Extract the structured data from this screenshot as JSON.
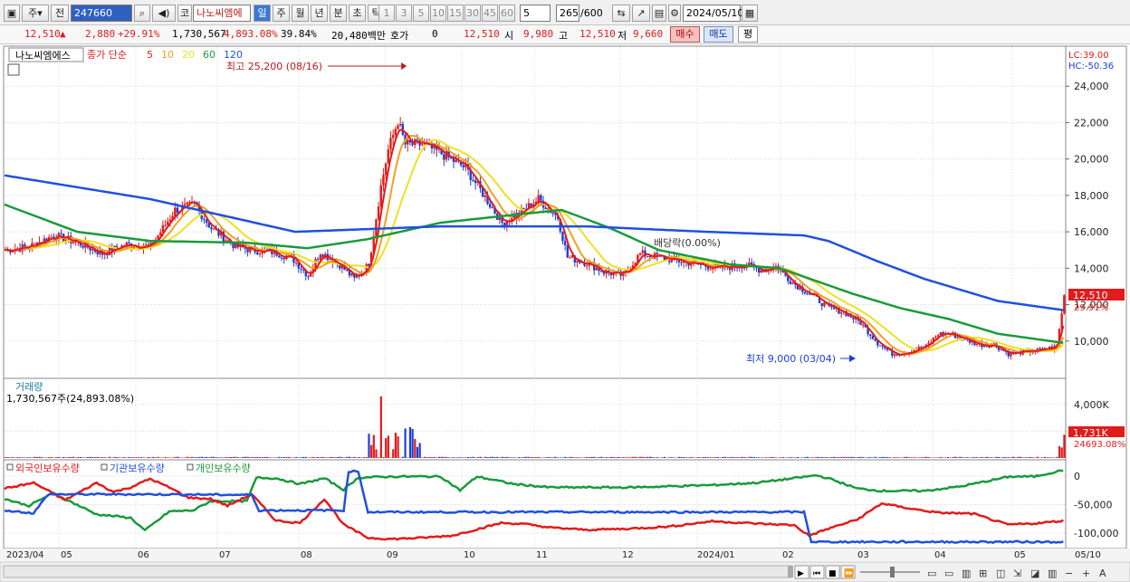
{
  "toolbar": {
    "market": "주",
    "prev": "전",
    "code": "247660",
    "stock_name": "나노씨엠에",
    "chart_type": "코",
    "periods": [
      "일",
      "주",
      "월",
      "년",
      "분",
      "초",
      "틱"
    ],
    "active_period": "일",
    "intervals": [
      "1",
      "3",
      "5",
      "10",
      "15",
      "30",
      "45",
      "60"
    ],
    "interval_input": "5",
    "count": "265",
    "count_max": "/600",
    "date": "2024/05/10"
  },
  "quote": {
    "price": "12,510",
    "change": "2,880",
    "change_pct": "+29.91%",
    "volume": "1,730,567",
    "vol_ratio": "4,893.08%",
    "turnover_pct": "39.84%",
    "amount": "20,480백만",
    "hoga_label": "호가",
    "hoga_val": "0",
    "ask": "12,510",
    "open_label": "시",
    "open": "9,980",
    "high_label": "고",
    "high": "12,510",
    "low_label": "저",
    "low": "9,660",
    "buy_label": "매수",
    "sell_label": "매도",
    "eval_label": "평"
  },
  "chart_data": {
    "type": "candlestick",
    "legend": {
      "name": "나노씨엠에스",
      "ma_label": "종가 단순",
      "ma_periods": [
        "5",
        "10",
        "20",
        "60",
        "120"
      ],
      "ma_colors": [
        "#e21b1b",
        "#f0a020",
        "#f0e020",
        "#1a9a3a",
        "#2050e0"
      ]
    },
    "price_axis": {
      "ticks": [
        "24,000",
        "22,000",
        "20,000",
        "18,000",
        "16,000",
        "14,000",
        "12,000",
        "10,000"
      ],
      "ylim": [
        8000,
        26000
      ]
    },
    "lc": "LC:39.00",
    "hc": "HC:-50.36",
    "last_price_tag": "12,510",
    "last_pct_tag": "29.91%",
    "high_annotation": "최고 25,200 (08/16)",
    "low_annotation": "최저 9,000 (03/04)",
    "dividend_annotation": "배당락(0.00%)",
    "volume": {
      "title": "거래량",
      "info": "1,730,567주(24,893.08%)",
      "ticks": [
        "4,000K",
        "2,000K"
      ],
      "tag": "1,731K",
      "tag_pct": "24693.08%",
      "ylim": [
        0,
        5000
      ]
    },
    "holdings": {
      "series": [
        {
          "name": "외국인보유수량",
          "color": "#e21b1b"
        },
        {
          "name": "기관보유수량",
          "color": "#2050e0"
        },
        {
          "name": "개인보유수량",
          "color": "#1a9a3a"
        }
      ],
      "ticks": [
        "0",
        "-50,000",
        "-100,000"
      ],
      "ylim": [
        -125000,
        25000
      ]
    },
    "x_labels": [
      "2023/04",
      "05",
      "06",
      "07",
      "08",
      "09",
      "10",
      "11",
      "12",
      "2024/01",
      "02",
      "03",
      "04",
      "05",
      "05/10"
    ],
    "close_path": [
      [
        0,
        15000
      ],
      [
        10,
        15200
      ],
      [
        20,
        15800
      ],
      [
        30,
        15400
      ],
      [
        40,
        14800
      ],
      [
        50,
        15300
      ],
      [
        60,
        15200
      ],
      [
        70,
        17200
      ],
      [
        78,
        17500
      ],
      [
        85,
        16200
      ],
      [
        95,
        15200
      ],
      [
        102,
        15000
      ],
      [
        110,
        14900
      ],
      [
        118,
        14600
      ],
      [
        125,
        13600
      ],
      [
        130,
        14900
      ],
      [
        138,
        14200
      ],
      [
        144,
        13400
      ],
      [
        150,
        14200
      ],
      [
        155,
        18500
      ],
      [
        158,
        20500
      ],
      [
        162,
        22100
      ],
      [
        165,
        20800
      ],
      [
        172,
        20800
      ],
      [
        180,
        20300
      ],
      [
        190,
        19500
      ],
      [
        197,
        18100
      ],
      [
        205,
        16500
      ],
      [
        212,
        17000
      ],
      [
        220,
        17800
      ],
      [
        228,
        16800
      ],
      [
        232,
        14600
      ],
      [
        240,
        14300
      ],
      [
        247,
        13800
      ],
      [
        255,
        13600
      ],
      [
        262,
        14800
      ],
      [
        270,
        14600
      ],
      [
        282,
        14300
      ],
      [
        295,
        14000
      ],
      [
        305,
        14200
      ],
      [
        312,
        13900
      ],
      [
        318,
        14100
      ],
      [
        325,
        13200
      ],
      [
        333,
        12500
      ],
      [
        340,
        11800
      ],
      [
        346,
        11600
      ],
      [
        353,
        11000
      ],
      [
        360,
        9900
      ],
      [
        366,
        9300
      ],
      [
        372,
        9400
      ],
      [
        380,
        9700
      ],
      [
        385,
        10400
      ],
      [
        390,
        10400
      ],
      [
        396,
        10100
      ],
      [
        402,
        9800
      ],
      [
        408,
        9800
      ],
      [
        414,
        9300
      ],
      [
        420,
        9400
      ],
      [
        428,
        9500
      ],
      [
        434,
        9700
      ],
      [
        437,
        12510
      ]
    ],
    "ma120_path": [
      [
        0,
        19100
      ],
      [
        60,
        17800
      ],
      [
        120,
        16000
      ],
      [
        180,
        16300
      ],
      [
        240,
        16300
      ],
      [
        290,
        16000
      ],
      [
        330,
        15800
      ],
      [
        340,
        15500
      ],
      [
        360,
        14400
      ],
      [
        380,
        13400
      ],
      [
        410,
        12200
      ],
      [
        437,
        11700
      ]
    ],
    "ma60_path": [
      [
        0,
        17500
      ],
      [
        30,
        16000
      ],
      [
        60,
        15500
      ],
      [
        100,
        15400
      ],
      [
        125,
        15100
      ],
      [
        150,
        15600
      ],
      [
        180,
        16500
      ],
      [
        215,
        17000
      ],
      [
        230,
        17200
      ],
      [
        250,
        16200
      ],
      [
        270,
        15000
      ],
      [
        300,
        14200
      ],
      [
        320,
        14000
      ],
      [
        335,
        13300
      ],
      [
        350,
        12600
      ],
      [
        370,
        11800
      ],
      [
        390,
        11200
      ],
      [
        410,
        10400
      ],
      [
        437,
        9900
      ]
    ],
    "foreign_path": [
      [
        0,
        -22000
      ],
      [
        12,
        -12000
      ],
      [
        25,
        -42000
      ],
      [
        38,
        -12000
      ],
      [
        45,
        -28000
      ],
      [
        52,
        -20000
      ],
      [
        60,
        -5000
      ],
      [
        68,
        -20000
      ],
      [
        76,
        -38000
      ],
      [
        85,
        -40000
      ],
      [
        92,
        -52000
      ],
      [
        102,
        -32000
      ],
      [
        112,
        -78000
      ],
      [
        122,
        -82000
      ],
      [
        132,
        -40000
      ],
      [
        140,
        -85000
      ],
      [
        150,
        -108000
      ],
      [
        160,
        -110000
      ],
      [
        172,
        -108000
      ],
      [
        185,
        -104000
      ],
      [
        205,
        -82000
      ],
      [
        215,
        -84000
      ],
      [
        225,
        -90000
      ],
      [
        240,
        -94000
      ],
      [
        258,
        -92000
      ],
      [
        275,
        -88000
      ],
      [
        292,
        -79000
      ],
      [
        310,
        -83000
      ],
      [
        326,
        -86000
      ],
      [
        332,
        -104000
      ],
      [
        340,
        -92000
      ],
      [
        352,
        -76000
      ],
      [
        362,
        -48000
      ],
      [
        374,
        -57000
      ],
      [
        385,
        -64000
      ],
      [
        400,
        -66000
      ],
      [
        414,
        -85000
      ],
      [
        425,
        -83000
      ],
      [
        437,
        -78000
      ]
    ],
    "inst_path": [
      [
        0,
        -60000
      ],
      [
        12,
        -65000
      ],
      [
        18,
        -32000
      ],
      [
        60,
        -32000
      ],
      [
        102,
        -33000
      ],
      [
        105,
        -60000
      ],
      [
        140,
        -60000
      ],
      [
        142,
        8000
      ],
      [
        146,
        8000
      ],
      [
        150,
        -63000
      ],
      [
        190,
        -63000
      ],
      [
        250,
        -63000
      ],
      [
        300,
        -63000
      ],
      [
        330,
        -63000
      ],
      [
        333,
        -115000
      ],
      [
        437,
        -115000
      ]
    ],
    "indiv_path": [
      [
        0,
        -40000
      ],
      [
        10,
        -52000
      ],
      [
        20,
        -30000
      ],
      [
        38,
        -67000
      ],
      [
        52,
        -73000
      ],
      [
        58,
        -95000
      ],
      [
        68,
        -62000
      ],
      [
        78,
        -60000
      ],
      [
        85,
        -44000
      ],
      [
        100,
        -44000
      ],
      [
        104,
        -3000
      ],
      [
        112,
        -4000
      ],
      [
        122,
        -14000
      ],
      [
        132,
        -4000
      ],
      [
        140,
        -24000
      ],
      [
        146,
        -3000
      ],
      [
        160,
        -1000
      ],
      [
        180,
        -1000
      ],
      [
        188,
        -25000
      ],
      [
        195,
        -1000
      ],
      [
        210,
        -14000
      ],
      [
        225,
        -20000
      ],
      [
        240,
        -20000
      ],
      [
        258,
        -20000
      ],
      [
        275,
        -18000
      ],
      [
        292,
        -16000
      ],
      [
        310,
        -12000
      ],
      [
        322,
        -6000
      ],
      [
        335,
        1000
      ],
      [
        340,
        -4000
      ],
      [
        352,
        -22000
      ],
      [
        362,
        -26000
      ],
      [
        380,
        -26000
      ],
      [
        395,
        -18000
      ],
      [
        415,
        -1000
      ],
      [
        425,
        -1000
      ],
      [
        437,
        10000
      ]
    ]
  }
}
